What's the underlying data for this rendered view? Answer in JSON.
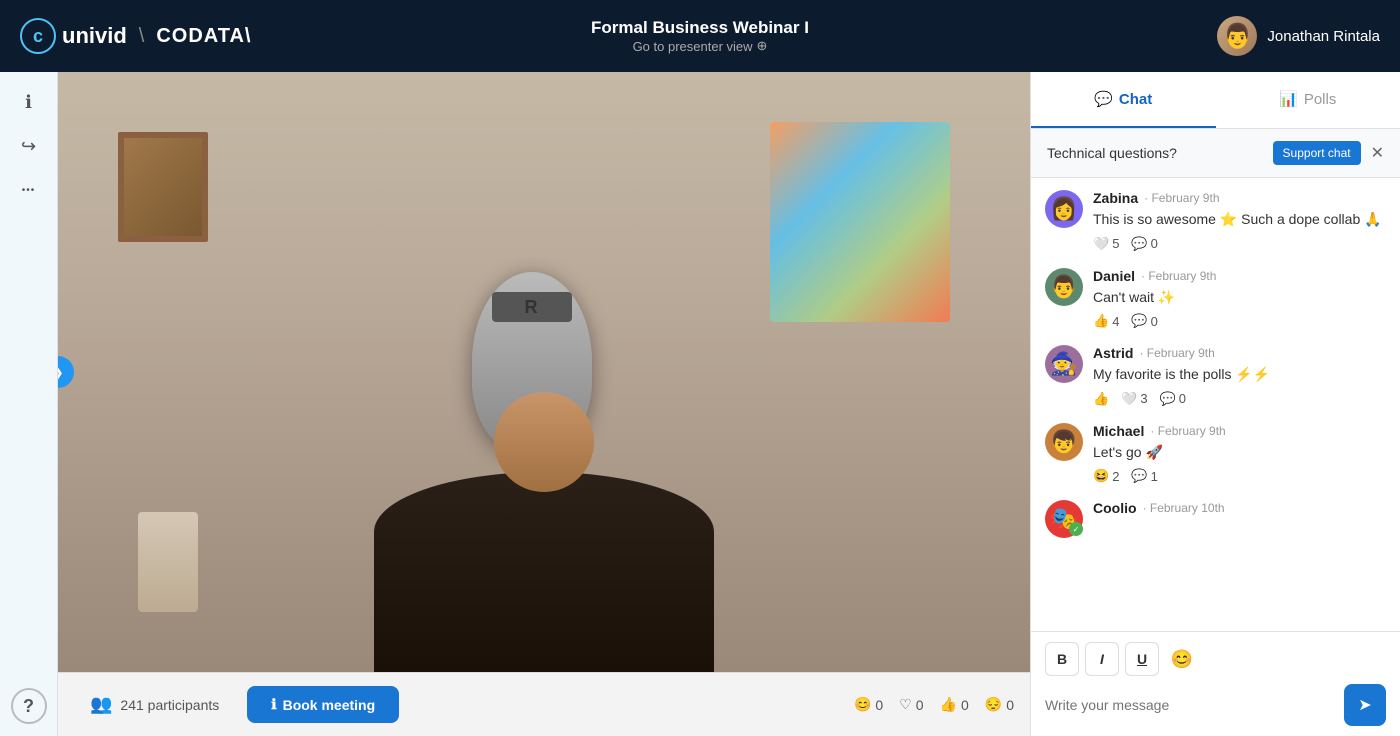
{
  "header": {
    "logo_text": "univid",
    "logo_icon": "ᴄ",
    "separator": "\\",
    "partner_name": "CODATA\\",
    "webinar_title": "Formal Business Webinar I",
    "presenter_link": "Go to presenter view",
    "user_name": "Jonathan Rintala",
    "user_avatar": "👤"
  },
  "sidebar": {
    "icons": [
      {
        "name": "info-icon",
        "symbol": "ℹ",
        "interactable": true
      },
      {
        "name": "share-icon",
        "symbol": "↪",
        "interactable": true
      },
      {
        "name": "more-icon",
        "symbol": "•••",
        "interactable": true
      }
    ],
    "help_icon": "?"
  },
  "video": {
    "participants_label": "241 participants",
    "book_meeting_label": "Book meeting",
    "reactions": [
      {
        "name": "emoji-reaction",
        "icon": "😊",
        "count": "0"
      },
      {
        "name": "heart-reaction",
        "icon": "♡",
        "count": "0"
      },
      {
        "name": "thumbsup-reaction",
        "icon": "👍",
        "count": "0"
      },
      {
        "name": "sad-reaction",
        "icon": "😔",
        "count": "0"
      }
    ],
    "expand_icon": "❯"
  },
  "chat_panel": {
    "tabs": [
      {
        "name": "chat-tab",
        "label": "Chat",
        "icon": "💬",
        "active": true
      },
      {
        "name": "polls-tab",
        "label": "Polls",
        "icon": "📊",
        "active": false
      }
    ],
    "tech_questions_label": "Technical questions?",
    "support_chat_btn": "Support chat",
    "messages": [
      {
        "id": "msg-1",
        "user": "Zabina",
        "time": "February 9th",
        "avatar_emoji": "👩",
        "avatar_bg": "#7b68ee",
        "text": "This is so awesome ⭐ Such a dope collab 🙏",
        "heart_count": "5",
        "comment_count": "0",
        "reaction_type": "heart"
      },
      {
        "id": "msg-2",
        "user": "Daniel",
        "time": "February 9th",
        "avatar_emoji": "👨",
        "avatar_bg": "#5d8a6e",
        "text": "Can't wait ✨",
        "heart_count": "4",
        "comment_count": "0",
        "reaction_type": "thumbsup"
      },
      {
        "id": "msg-3",
        "user": "Astrid",
        "time": "February 9th",
        "avatar_emoji": "🧙",
        "avatar_bg": "#9c6e9c",
        "text": "My favorite is the polls ⚡⚡",
        "heart_count": "3",
        "comment_count": "0",
        "reaction_type": "thumbsup_heart"
      },
      {
        "id": "msg-4",
        "user": "Michael",
        "time": "February 9th",
        "avatar_emoji": "👦",
        "avatar_bg": "#c8803a",
        "text": "Let's go 🚀",
        "heart_count": "2",
        "comment_count": "1",
        "reaction_type": "laugh"
      },
      {
        "id": "msg-5",
        "user": "Coolio",
        "time": "February 10th",
        "avatar_emoji": "🎭",
        "avatar_bg": "#e53935",
        "text": "",
        "partial": true
      }
    ],
    "input_placeholder": "Write your message",
    "toolbar_buttons": [
      {
        "name": "bold-btn",
        "label": "B"
      },
      {
        "name": "italic-btn",
        "label": "I"
      },
      {
        "name": "underline-btn",
        "label": "U"
      },
      {
        "name": "emoji-btn",
        "label": "😊"
      }
    ],
    "send_label": "Send"
  }
}
